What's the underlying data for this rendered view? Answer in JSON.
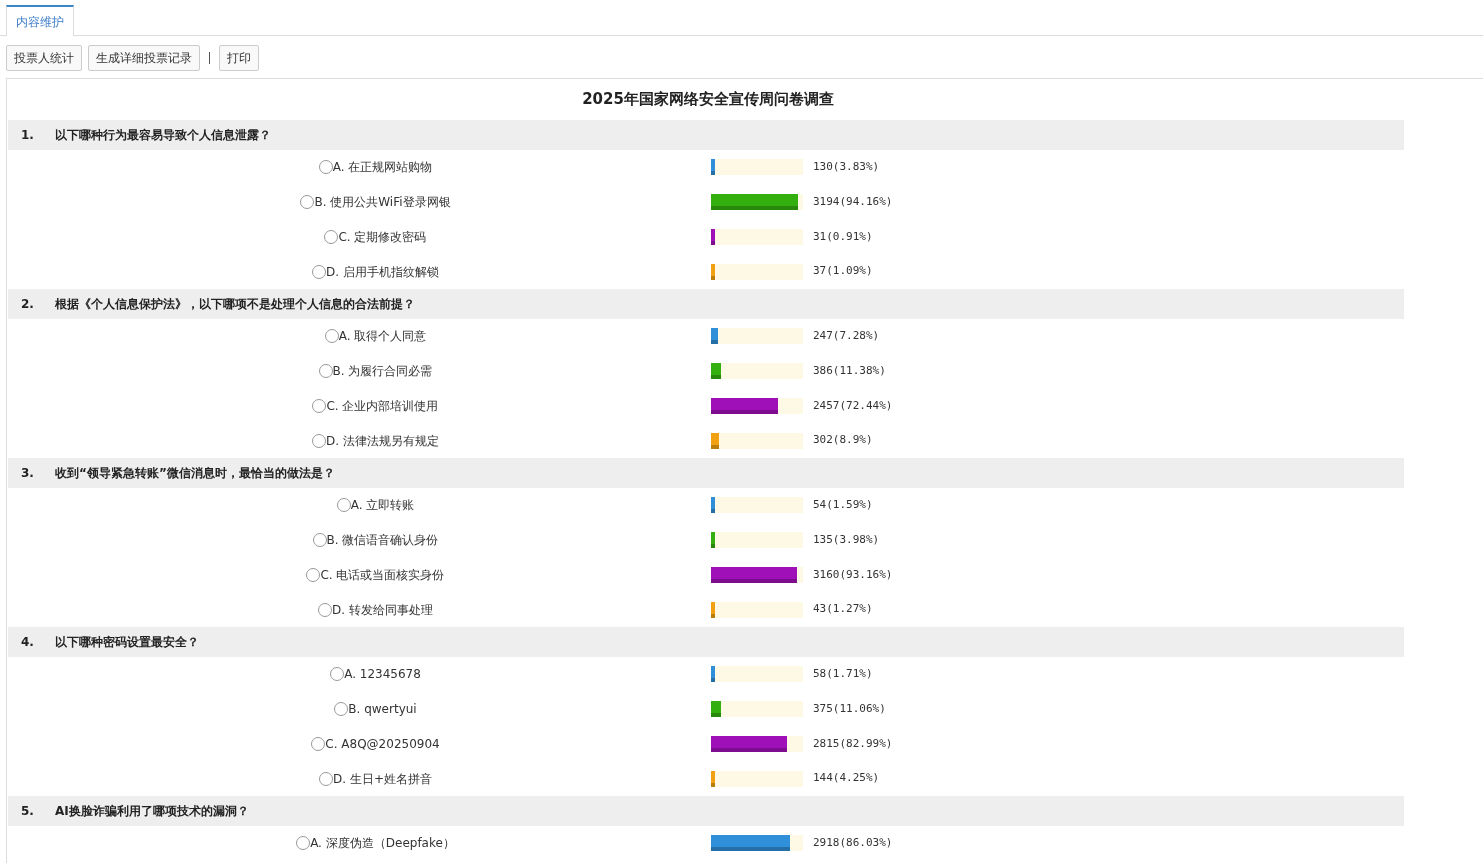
{
  "tabs": [
    {
      "label": "内容维护",
      "selected": true
    }
  ],
  "toolbar": [
    "投票人统计",
    "生成详细投票记录",
    "打印"
  ],
  "title": "2025年国家网络安全宣传周问卷调查",
  "questions": [
    {
      "number": "1.",
      "text": "以下哪种行为最容易导致个人信息泄露？",
      "options": [
        {
          "label": "A. 在正规网站购物",
          "level": 0.0383,
          "reading": "130(3.83%)",
          "color": "#2f8fd8",
          "selected": false
        },
        {
          "label": "B. 使用公共WiFi登录网银",
          "level": 0.9416,
          "reading": "3194(94.16%)",
          "color": "#33b010",
          "selected": false
        },
        {
          "label": "C. 定期修改密码",
          "level": 0.0091,
          "reading": "31(0.91%)",
          "color": "#a010b8",
          "selected": false
        },
        {
          "label": "D. 启用手机指纹解锁",
          "level": 0.0109,
          "reading": "37(1.09%)",
          "color": "#f0a010",
          "selected": false
        }
      ]
    },
    {
      "number": "2.",
      "text": "根据《个人信息保护法》，以下哪项不是处理个人信息的合法前提？",
      "options": [
        {
          "label": "A. 取得个人同意",
          "level": 0.0728,
          "reading": "247(7.28%)",
          "color": "#2f8fd8",
          "selected": false
        },
        {
          "label": "B. 为履行合同必需",
          "level": 0.1138,
          "reading": "386(11.38%)",
          "color": "#33b010",
          "selected": false
        },
        {
          "label": "C. 企业内部培训使用",
          "level": 0.7244,
          "reading": "2457(72.44%)",
          "color": "#a010b8",
          "selected": false
        },
        {
          "label": "D. 法律法规另有规定",
          "level": 0.089,
          "reading": "302(8.9%)",
          "color": "#f0a010",
          "selected": false
        }
      ]
    },
    {
      "number": "3.",
      "text": "收到“领导紧急转账”微信消息时，最恰当的做法是？",
      "options": [
        {
          "label": "A. 立即转账",
          "level": 0.0159,
          "reading": "54(1.59%)",
          "color": "#2f8fd8",
          "selected": false
        },
        {
          "label": "B. 微信语音确认身份",
          "level": 0.0398,
          "reading": "135(3.98%)",
          "color": "#33b010",
          "selected": false
        },
        {
          "label": "C. 电话或当面核实身份",
          "level": 0.9316,
          "reading": "3160(93.16%)",
          "color": "#a010b8",
          "selected": false
        },
        {
          "label": "D. 转发给同事处理",
          "level": 0.0127,
          "reading": "43(1.27%)",
          "color": "#f0a010",
          "selected": false
        }
      ]
    },
    {
      "number": "4.",
      "text": "以下哪种密码设置最安全？",
      "options": [
        {
          "label": "A. 12345678",
          "level": 0.0171,
          "reading": "58(1.71%)",
          "color": "#2f8fd8",
          "selected": false
        },
        {
          "label": "B. qwertyui",
          "level": 0.1106,
          "reading": "375(11.06%)",
          "color": "#33b010",
          "selected": false
        },
        {
          "label": "C. A8Q@20250904",
          "level": 0.8299,
          "reading": "2815(82.99%)",
          "color": "#a010b8",
          "selected": false
        },
        {
          "label": "D. 生日+姓名拼音",
          "level": 0.0425,
          "reading": "144(4.25%)",
          "color": "#f0a010",
          "selected": false
        }
      ]
    },
    {
      "number": "5.",
      "text": "AI换脸诈骗利用了哪项技术的漏洞？",
      "options": [
        {
          "label": "A. 深度伪造（Deepfake）",
          "level": 0.8603,
          "reading": "2918(86.03%)",
          "color": "#2f8fd8",
          "selected": false
        }
      ]
    }
  ]
}
